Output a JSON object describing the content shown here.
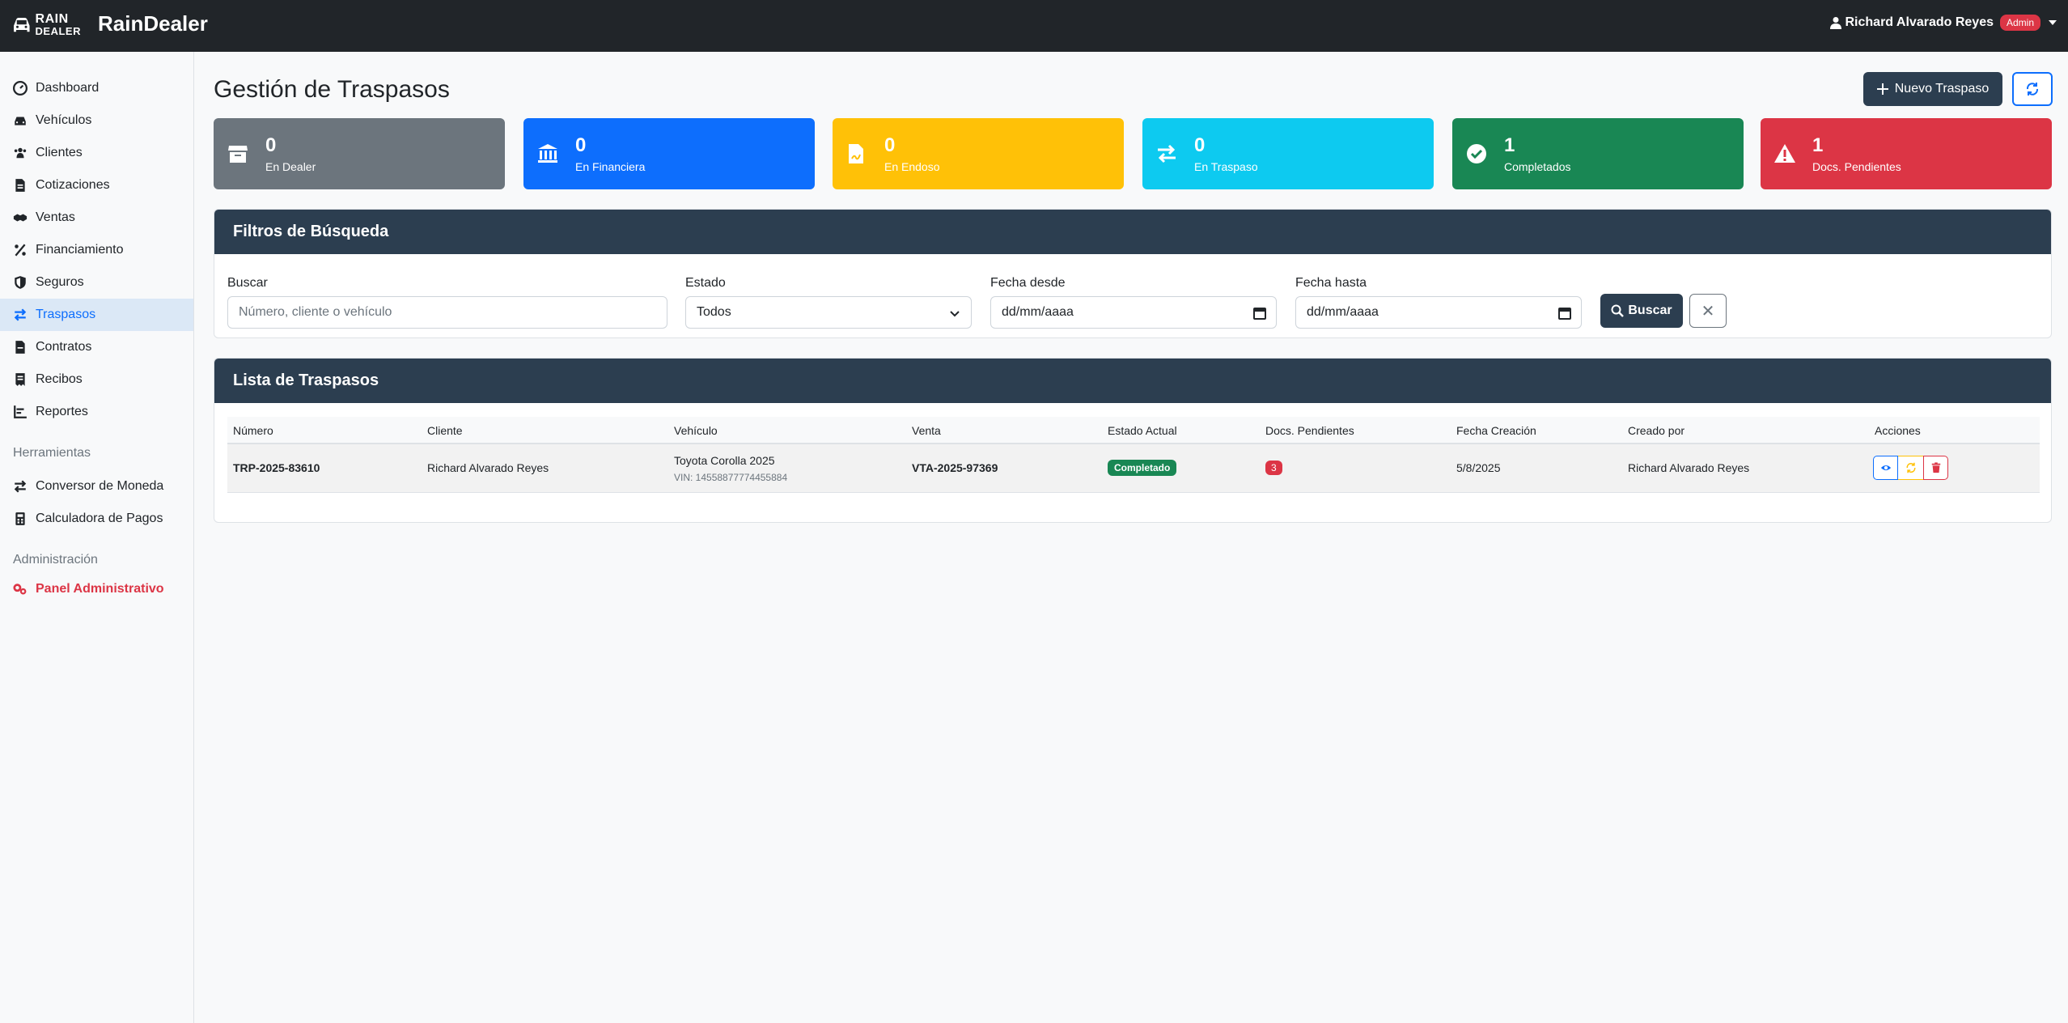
{
  "header": {
    "logo_line1": "RAIN",
    "logo_line2": "DEALER",
    "brand": "RainDealer",
    "user_name": "Richard Alvarado Reyes",
    "role_badge": "Admin"
  },
  "sidebar": {
    "items": [
      {
        "label": "Dashboard",
        "icon": "dashboard-icon"
      },
      {
        "label": "Vehículos",
        "icon": "car-icon"
      },
      {
        "label": "Clientes",
        "icon": "users-icon"
      },
      {
        "label": "Cotizaciones",
        "icon": "file-icon"
      },
      {
        "label": "Ventas",
        "icon": "handshake-icon"
      },
      {
        "label": "Financiamiento",
        "icon": "percent-icon"
      },
      {
        "label": "Seguros",
        "icon": "shield-icon"
      },
      {
        "label": "Traspasos",
        "icon": "exchange-icon",
        "active": true
      },
      {
        "label": "Contratos",
        "icon": "contract-icon"
      },
      {
        "label": "Recibos",
        "icon": "receipt-icon"
      },
      {
        "label": "Reportes",
        "icon": "chart-icon"
      }
    ],
    "tools_section": "Herramientas",
    "tools": [
      {
        "label": "Conversor de Moneda",
        "icon": "exchange-icon"
      },
      {
        "label": "Calculadora de Pagos",
        "icon": "calculator-icon"
      }
    ],
    "admin_section": "Administración",
    "admin_item": "Panel Administrativo"
  },
  "main": {
    "title": "Gestión de Traspasos",
    "new_button": "Nuevo Traspaso",
    "stats": [
      {
        "value": "0",
        "label": "En Dealer",
        "color": "#6c757d",
        "icon": "store-icon"
      },
      {
        "value": "0",
        "label": "En Financiera",
        "color": "#0d6efd",
        "icon": "bank-icon"
      },
      {
        "value": "0",
        "label": "En Endoso",
        "color": "#ffc107",
        "icon": "signature-icon"
      },
      {
        "value": "0",
        "label": "En Traspaso",
        "color": "#0dcaf0",
        "icon": "exchange-icon"
      },
      {
        "value": "1",
        "label": "Completados",
        "color": "#198754",
        "icon": "check-circle-icon"
      },
      {
        "value": "1",
        "label": "Docs. Pendientes",
        "color": "#dc3545",
        "icon": "warning-icon"
      }
    ],
    "filters": {
      "title": "Filtros de Búsqueda",
      "search_label": "Buscar",
      "search_placeholder": "Número, cliente o vehículo",
      "status_label": "Estado",
      "status_value": "Todos",
      "from_label": "Fecha desde",
      "from_value": "dd/mm/aaaa",
      "to_label": "Fecha hasta",
      "to_value": "dd/mm/aaaa",
      "search_button": "Buscar",
      "clear_button": "✕"
    },
    "list": {
      "title": "Lista de Traspasos",
      "columns": [
        "Número",
        "Cliente",
        "Vehículo",
        "Venta",
        "Estado Actual",
        "Docs. Pendientes",
        "Fecha Creación",
        "Creado por",
        "Acciones"
      ],
      "rows": [
        {
          "numero": "TRP-2025-83610",
          "cliente": "Richard Alvarado Reyes",
          "vehiculo": "Toyota Corolla 2025",
          "vin": "VIN: 14558877774455884",
          "venta": "VTA-2025-97369",
          "estado": "Completado",
          "docs": "3",
          "fecha": "5/8/2025",
          "creado_por": "Richard Alvarado Reyes"
        }
      ]
    }
  }
}
